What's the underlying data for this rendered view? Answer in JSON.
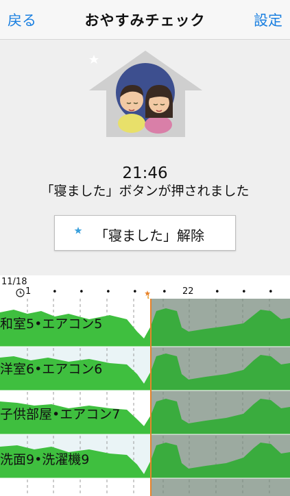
{
  "nav": {
    "back": "戻る",
    "title": "おやすみチェック",
    "settings": "設定"
  },
  "status": {
    "time": "21:46",
    "message": "「寝ました」ボタンが押されました"
  },
  "release_button": {
    "label": "「寝ました」解除"
  },
  "timeline": {
    "date": "11/18",
    "tick_first": "1",
    "tick_22": "22",
    "rows": [
      {
        "label": "和室5•エアコン5"
      },
      {
        "label": "洋室6•エアコン6"
      },
      {
        "label": "子供部屋•エアコン7"
      },
      {
        "label": "洗面9•洗濯機9"
      }
    ]
  },
  "colors": {
    "accent": "#1a7fe0",
    "graph_green": "#3fbf3f",
    "graph_green_dark": "#2f9f4f",
    "marker_orange": "#e8822a",
    "shade_gray": "#bdbdbd"
  },
  "icons": [
    "house-icon",
    "family-icon",
    "moon-star-icon",
    "clock-icon"
  ]
}
